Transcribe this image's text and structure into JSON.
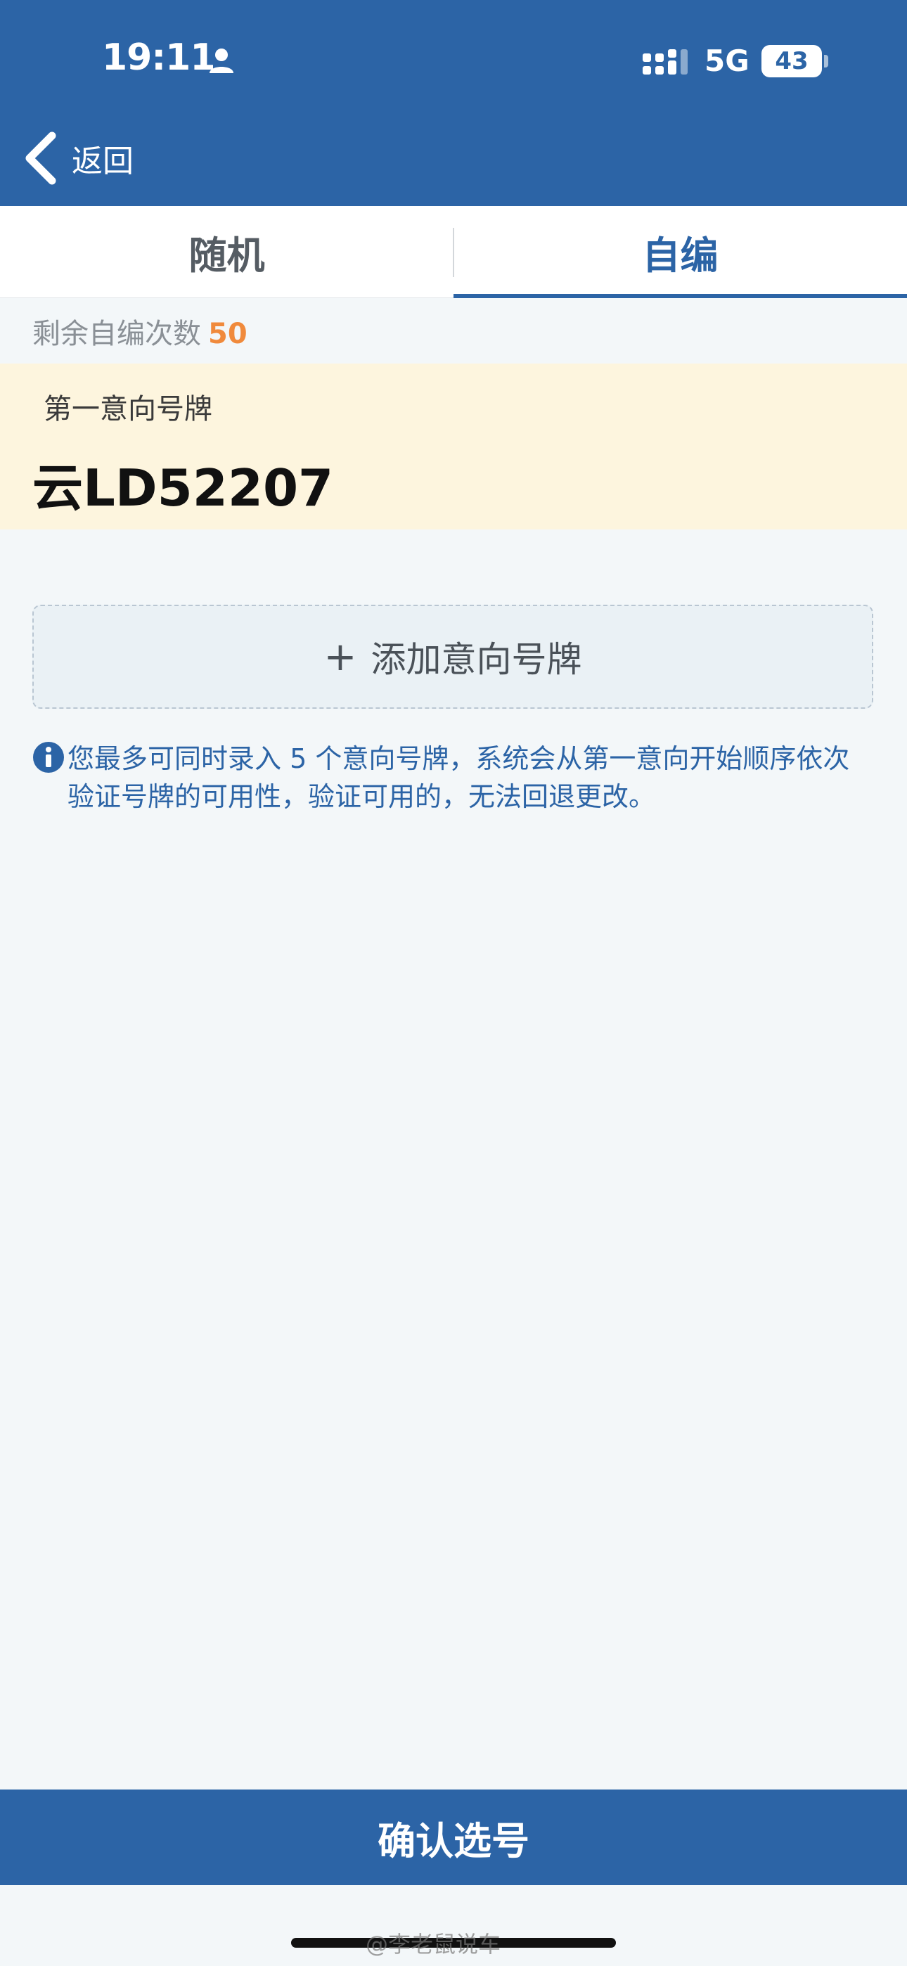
{
  "status_bar": {
    "time": "19:11",
    "network": "5G",
    "battery": "43"
  },
  "header": {
    "back_label": "返回"
  },
  "tabs": [
    {
      "label": "随机",
      "active": false
    },
    {
      "label": "自编",
      "active": true
    }
  ],
  "remaining": {
    "label": "剩余自编次数",
    "count": "50"
  },
  "intention": {
    "label": "第一意向号牌",
    "plate": "云LD52207"
  },
  "add_button": {
    "plus": "+",
    "label": "添加意向号牌"
  },
  "notice": {
    "text": "您最多可同时录入 5 个意向号牌，系统会从第一意向开始顺序依次验证号牌的可用性，验证可用的，无法回退更改。"
  },
  "confirm_button": {
    "label": "确认选号"
  },
  "watermark": "@李老鼠说车",
  "colors": {
    "primary": "#2c64a6",
    "accent": "#f08a3c",
    "card": "#fdf5de",
    "background": "#f3f7f9"
  },
  "icons": [
    "person-icon",
    "signal-icon",
    "back-chevron-icon",
    "info-icon"
  ]
}
